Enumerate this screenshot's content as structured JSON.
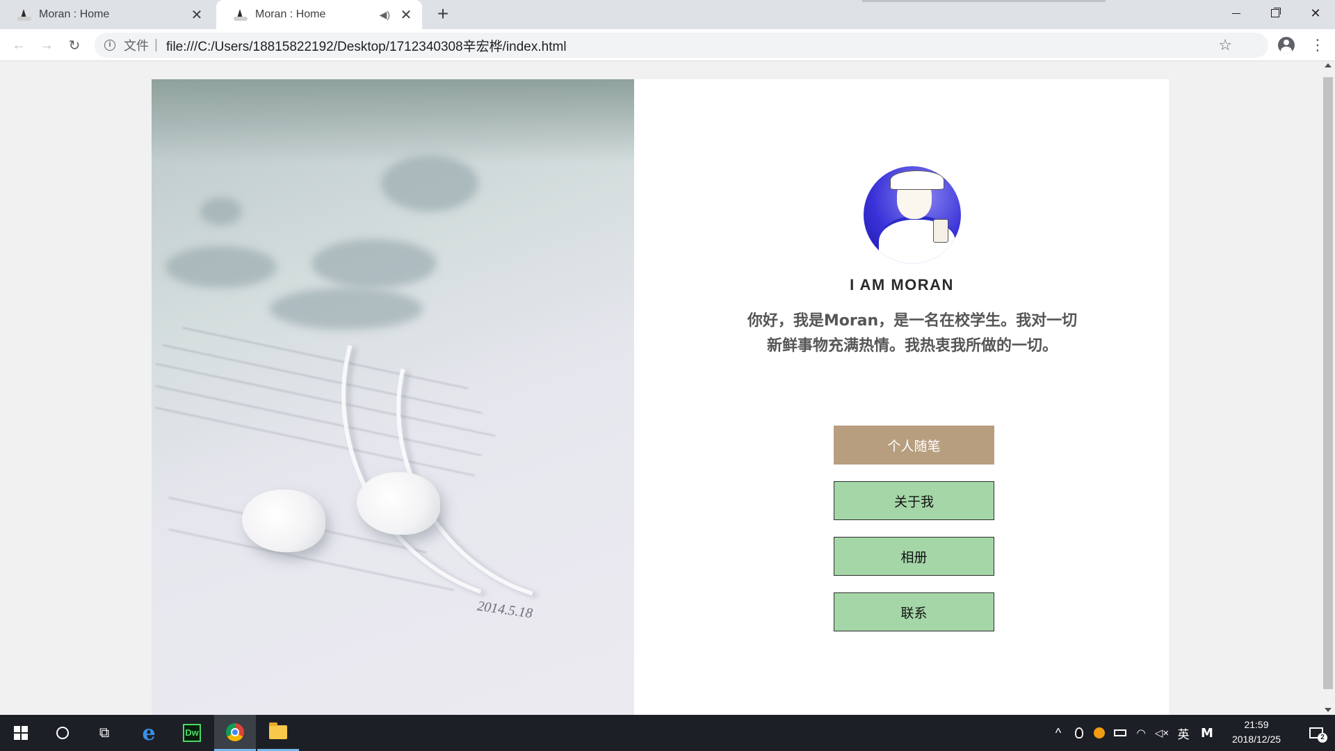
{
  "browser": {
    "tabs": [
      {
        "title": "Moran : Home",
        "active": false
      },
      {
        "title": "Moran : Home",
        "active": true,
        "audio_icon": "speaker-icon"
      }
    ],
    "new_tab_icon": "plus-icon",
    "omnibox": {
      "scheme_chip": "文件",
      "separator": "|",
      "url": "file:///C:/Users/18815822192/Desktop/1712340308辛宏桦/index.html"
    }
  },
  "page": {
    "name": "I AM MORAN",
    "intro": "你好，我是Moran，是一名在校学生。我对一切新鲜事物充满热情。我热衷我所做的一切。",
    "photo_date": "2014.5.18",
    "buttons": {
      "essays": "个人随笔",
      "about": "关于我",
      "album": "相册",
      "contact": "联系"
    },
    "colors": {
      "primary_button": "#b79e7f",
      "secondary_button": "#a5d6a7"
    }
  },
  "taskbar": {
    "apps": [
      "windows-start",
      "cortana-search",
      "task-view",
      "edge",
      "dreamweaver",
      "chrome",
      "file-explorer"
    ],
    "dw_label": "Dw",
    "tray": {
      "language": "英",
      "ime": "M"
    },
    "clock": {
      "time": "21:59",
      "date": "2018/12/25"
    },
    "notification_count": "2"
  }
}
